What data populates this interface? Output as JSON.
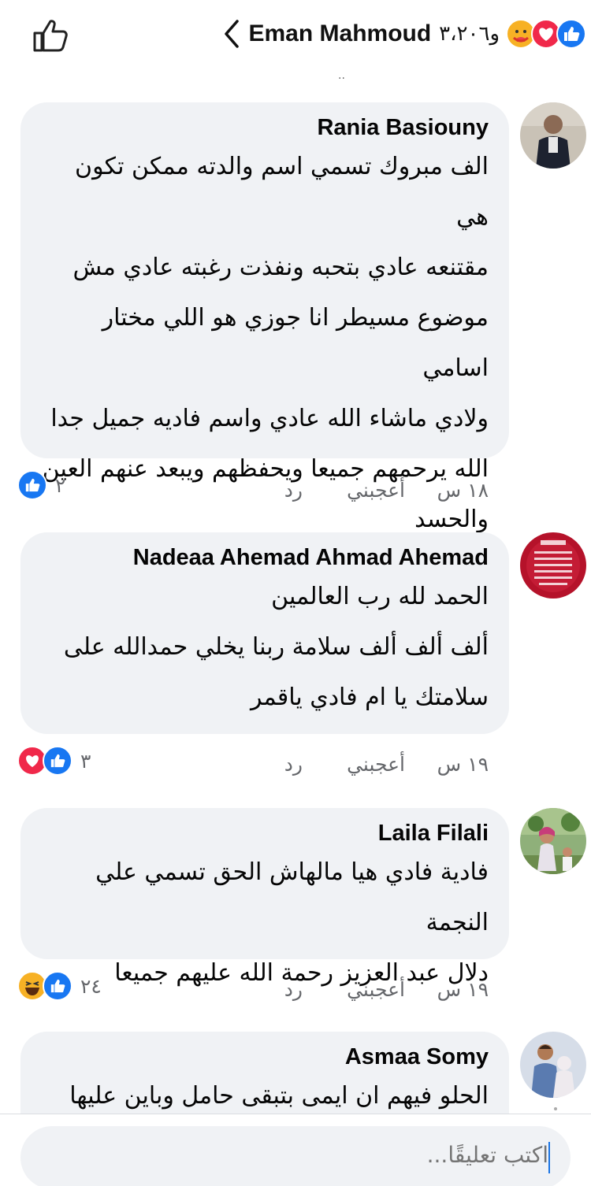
{
  "header": {
    "name": "Eman Mahmoud",
    "reaction_count": "و٣،٢٠٦",
    "reactions": [
      "like-icon",
      "love-icon",
      "care-icon"
    ],
    "like_button_icon": "thumbs-up-outline-icon",
    "back_icon": "chevron-left-icon"
  },
  "colors": {
    "like_blue": "#1877f2",
    "love_red": "#f0284a",
    "care_yellow": "#f7b125",
    "bubble_bg": "#f0f2f5",
    "meta_gray": "#65676b"
  },
  "comments": [
    {
      "author": "Rania Basiouny",
      "lines": [
        "الف مبروك تسمي اسم والدته ممكن تكون هي",
        "مقتنعه عادي بتحبه ونفذت رغبته عادي مش",
        "موضوع مسيطر انا جوزي هو اللي مختار اسامي",
        "ولادي ماشاء الله عادي واسم فاديه جميل جدا",
        "الله يرحمهم جميعا ويحفظهم ويبعد عنهم العين",
        "والحسد"
      ],
      "time": "١٨ س",
      "like_label": "أعجبني",
      "reply_label": "رد",
      "reaction_count": "٢",
      "reactions": [
        "like-icon"
      ]
    },
    {
      "author": "Nadeaa Ahemad Ahmad Ahemad",
      "lines": [
        "الحمد لله رب العالمين",
        "ألف ألف ألف سلامة ربنا يخلي حمدالله على",
        "سلامتك يا ام فادي ياقمر"
      ],
      "time": "١٩ س",
      "like_label": "أعجبني",
      "reply_label": "رد",
      "reaction_count": "٣",
      "reactions": [
        "like-icon",
        "love-icon"
      ]
    },
    {
      "author": "Laila Filali",
      "lines": [
        "فادية فادي هيا مالهاش الحق تسمي علي النجمة",
        "دلال عبد العزيز رحمة الله عليهم جميعا"
      ],
      "time": "١٩ س",
      "like_label": "أعجبني",
      "reply_label": "رد",
      "reaction_count": "٢٤",
      "reactions": [
        "like-icon",
        "haha-icon"
      ]
    },
    {
      "author": "Asmaa Somy",
      "lines": [
        "الحلو فيهم ان ايمى بتبقى حامل وباين عليها"
      ]
    }
  ],
  "composer": {
    "placeholder": "اكتب تعليقًا..."
  }
}
